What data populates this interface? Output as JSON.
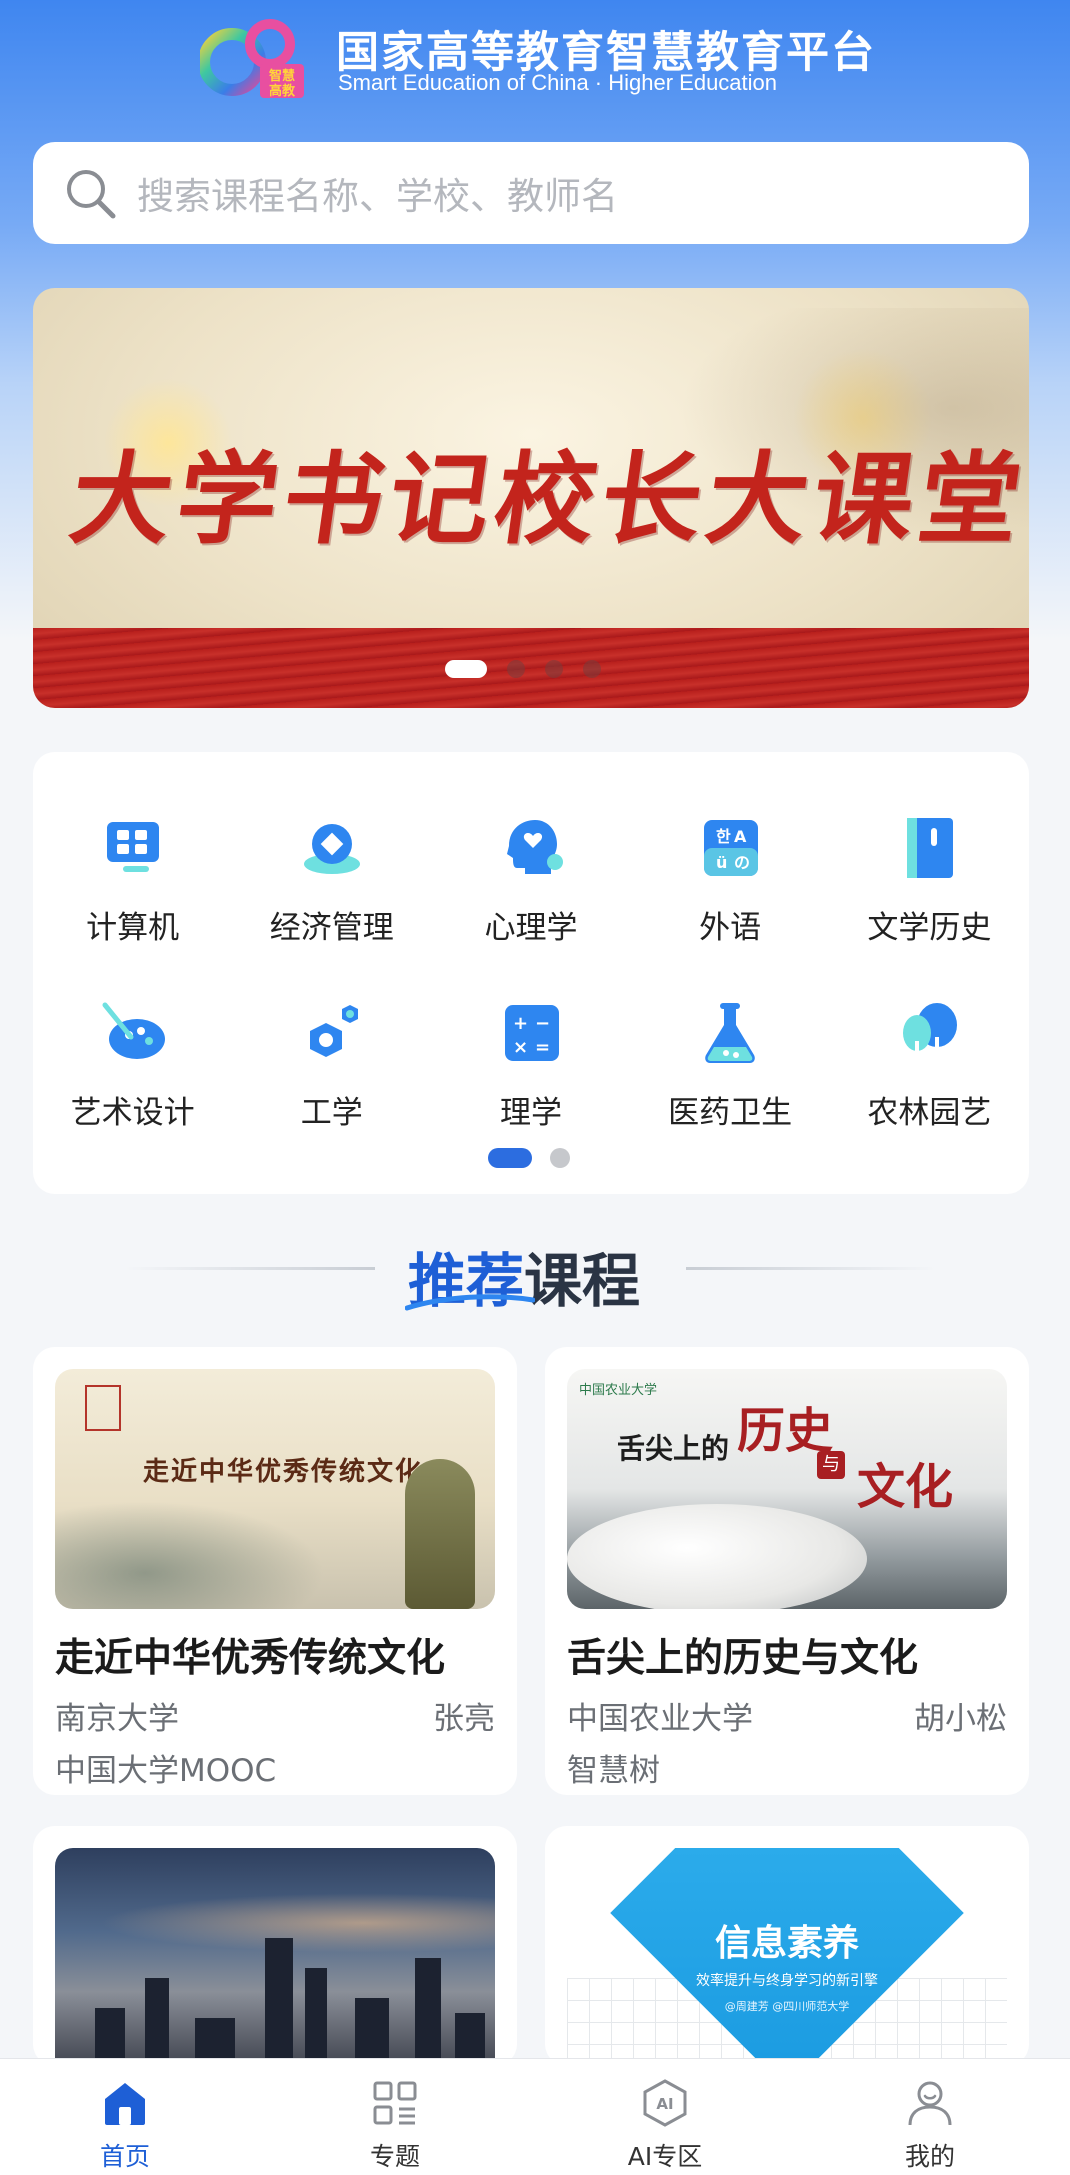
{
  "header": {
    "title_cn": "国家高等教育智慧教育平台",
    "title_en": "Smart Education of China · Higher Education",
    "logo_text": "智慧高教"
  },
  "search": {
    "placeholder": "搜索课程名称、学校、教师名"
  },
  "banner": {
    "title": "大学书记校长大课堂",
    "slide_count": 4,
    "active_slide": 1
  },
  "categories": {
    "items": [
      {
        "label": "计算机",
        "icon": "computer-icon"
      },
      {
        "label": "经济管理",
        "icon": "economics-icon"
      },
      {
        "label": "心理学",
        "icon": "psychology-icon"
      },
      {
        "label": "外语",
        "icon": "language-icon"
      },
      {
        "label": "文学历史",
        "icon": "book-icon"
      },
      {
        "label": "艺术设计",
        "icon": "palette-icon"
      },
      {
        "label": "工学",
        "icon": "engineering-icon"
      },
      {
        "label": "理学",
        "icon": "calculator-icon"
      },
      {
        "label": "医药卫生",
        "icon": "flask-icon"
      },
      {
        "label": "农林园艺",
        "icon": "tree-icon"
      }
    ],
    "page_count": 2,
    "active_page": 1
  },
  "section": {
    "title_highlight": "推荐",
    "title_rest": "课程"
  },
  "courses": [
    {
      "title": "走近中华优秀传统文化",
      "school": "南京大学",
      "teacher": "张亮",
      "platform": "中国大学MOOC",
      "cover_text": "走近中华优秀传统文化"
    },
    {
      "title": "舌尖上的历史与文化",
      "school": "中国农业大学",
      "teacher": "胡小松",
      "platform": "智慧树",
      "cover_text_1": "舌尖上的",
      "cover_text_2": "历史",
      "cover_text_3": "与",
      "cover_text_4": "文化"
    },
    {
      "title": "",
      "school": "",
      "teacher": "",
      "platform": ""
    },
    {
      "title": "",
      "school": "",
      "teacher": "",
      "platform": "",
      "cover_title": "信息素养",
      "cover_subtitle": "效率提升与终身学习的新引擎",
      "cover_credit": "@周建芳 @四川师范大学"
    }
  ],
  "bottom_nav": {
    "items": [
      {
        "label": "首页",
        "icon": "home-icon",
        "active": true
      },
      {
        "label": "专题",
        "icon": "topics-icon",
        "active": false
      },
      {
        "label": "AI专区",
        "icon": "ai-icon",
        "active": false
      },
      {
        "label": "我的",
        "icon": "profile-icon",
        "active": false
      }
    ]
  },
  "colors": {
    "accent": "#1e5fd6",
    "banner_red": "#c3241c",
    "header_blue": "#3f86f0"
  }
}
